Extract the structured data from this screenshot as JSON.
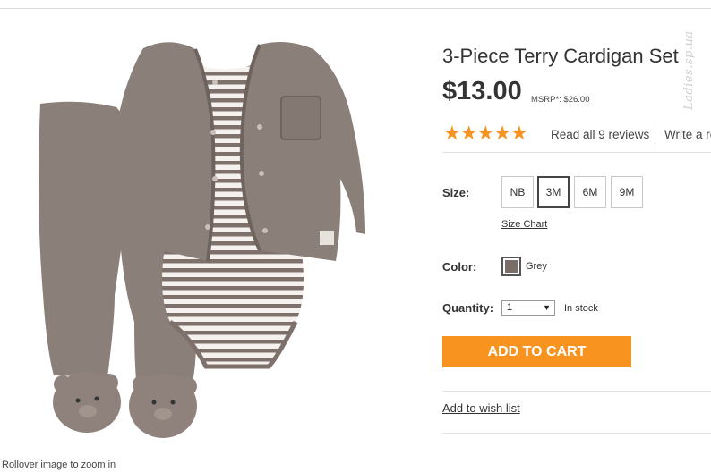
{
  "watermark": "Ladies.sp.ua",
  "product": {
    "title": "3-Piece Terry Cardigan Set",
    "price": "$13.00",
    "msrp": "MSRP*: $26.00",
    "rating_stars": 5,
    "reviews_link": "Read all 9 reviews",
    "write_review": "Write a review"
  },
  "image": {
    "zoom_hint": "Rollover image to zoom in",
    "colors": {
      "cardigan": "#8b7f79",
      "stripe": "#7e716b",
      "body": "#ffffff"
    }
  },
  "size": {
    "label": "Size:",
    "options": [
      "NB",
      "3M",
      "6M",
      "9M"
    ],
    "selected": "3M",
    "chart_link": "Size Chart"
  },
  "color": {
    "label": "Color:",
    "name": "Grey",
    "swatch": "#7a6d68"
  },
  "quantity": {
    "label": "Quantity:",
    "value": "1",
    "stock": "In stock"
  },
  "actions": {
    "add_to_cart": "ADD TO CART",
    "wish_list": "Add to wish list"
  },
  "theme": {
    "accent": "#f7931e",
    "text": "#333333"
  }
}
